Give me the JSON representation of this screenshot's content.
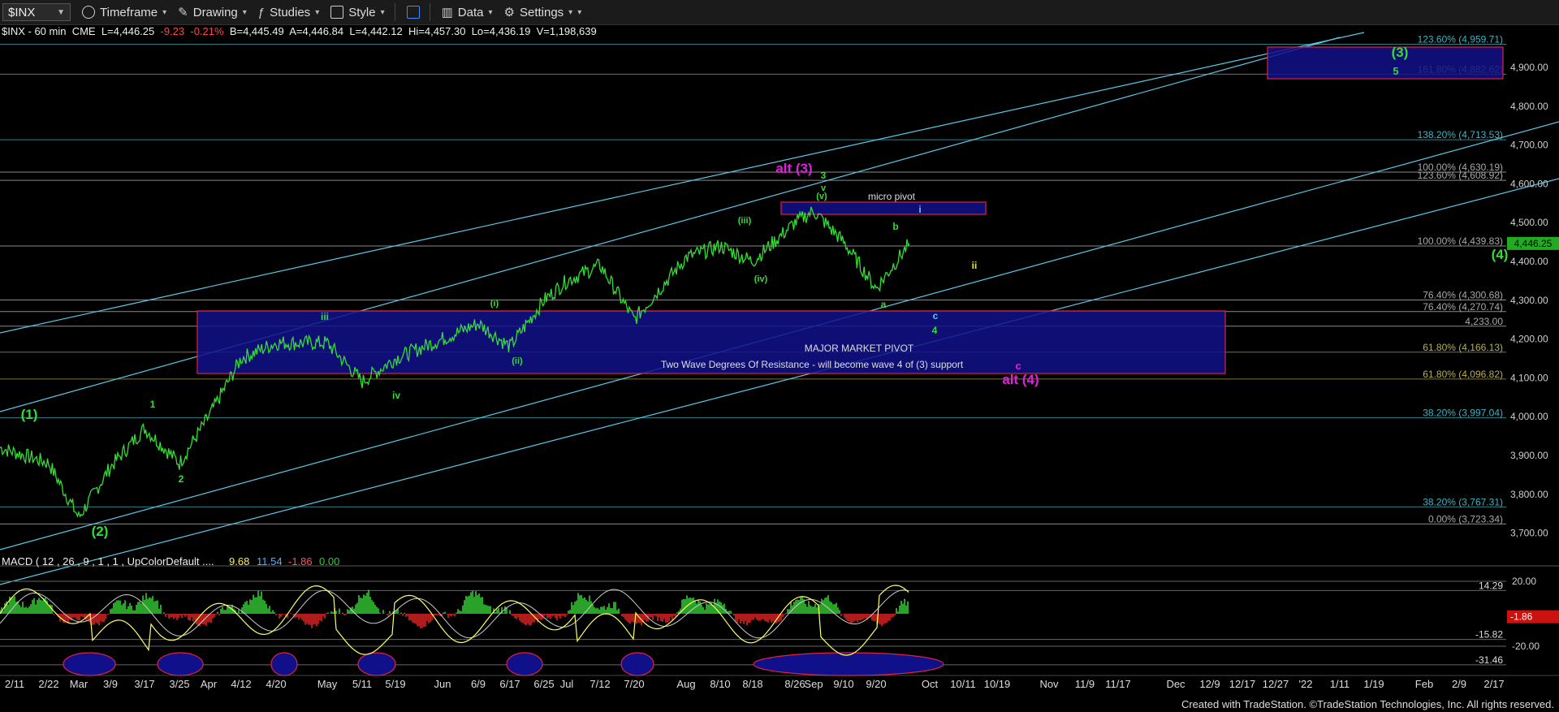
{
  "toolbar": {
    "symbol": "$INX",
    "items": [
      {
        "label": "Timeframe",
        "icon": "clock-icon"
      },
      {
        "label": "Drawing",
        "icon": "pencil-icon"
      },
      {
        "label": "Studies",
        "icon": "studies-icon"
      },
      {
        "label": "Style",
        "icon": "style-icon"
      },
      {
        "label": "",
        "icon": "layout-icon"
      },
      {
        "label": "Data",
        "icon": "data-icon"
      },
      {
        "label": "Settings",
        "icon": "gear-icon"
      }
    ]
  },
  "header": {
    "name": "$INX - 60 min  CME",
    "last": "L=4,446.25",
    "change": "-9.23",
    "pct": "-0.21%",
    "bid": "B=4,445.49",
    "ask": "A=4,446.84",
    "bar_last": "L=4,442.12",
    "hi": "Hi=4,457.30",
    "lo": "Lo=4,436.19",
    "vol": "V=1,198,639"
  },
  "footer": "Created with TradeStation. ©TradeStation Technologies, Inc. All rights reserved.",
  "colors": {
    "background": "#000000",
    "price": "#33dd33",
    "channel": "#5bc8e8",
    "zone_fill": "#10108a",
    "zone_border": "#dd2244",
    "fib_text": "#39b5c4",
    "fib_yellow": "#b8b04a",
    "wave_green": "#33dd33",
    "wave_magenta": "#dd22dd",
    "wave_yellow": "#e8e820",
    "macd_line": "#ffff66",
    "macd_signal": "#cccccc",
    "hist_pos": "#33cc33",
    "hist_neg": "#dd2222",
    "oval_fill": "#10108a"
  },
  "chart_data": [
    {
      "type": "line",
      "series": [
        {
          "x": [
            "2/11",
            "2/22",
            "Mar",
            "3/9",
            "3/17",
            "3/25",
            "Apr",
            "4/12",
            "4/20",
            "May",
            "5/11",
            "5/19",
            "Jun",
            "6/9",
            "6/17",
            "6/25",
            "Jul",
            "7/12",
            "7/20",
            "Aug",
            "8/10",
            "8/18",
            "8/26",
            "Sep",
            "9/10",
            "9/20",
            "Oct"
          ],
          "values": [
            3920,
            3880,
            3740,
            3870,
            3970,
            3880,
            4000,
            4150,
            4190,
            4190,
            4090,
            4150,
            4200,
            4240,
            4180,
            4300,
            4350,
            4390,
            4250,
            4410,
            4440,
            4400,
            4500,
            4530,
            4450,
            4330,
            4446
          ]
        }
      ],
      "yticks": [
        "3,700.00",
        "3,800.00",
        "3,900.00",
        "4,000.00",
        "4,100.00",
        "4,200.00",
        "4,300.00",
        "4,400.00",
        "4,500.00",
        "4,600.00",
        "4,700.00",
        "4,800.00",
        "4,900.00"
      ],
      "ylim": [
        3630,
        4990
      ],
      "last_price_label": "4,446.25",
      "fib_levels": [
        {
          "label": "123.60% (4,959.71)",
          "value": 4959.71,
          "color": "cyan"
        },
        {
          "label": "161.80% (4,882.62)",
          "value": 4882.62,
          "color": "yellow"
        },
        {
          "label": "138.20% (4,713.53)",
          "value": 4713.53,
          "color": "cyan"
        },
        {
          "label": "100.00% (4,630.19)",
          "value": 4630.19,
          "color": "white"
        },
        {
          "label": "123.60% (4,608.92)",
          "value": 4608.92,
          "color": "white"
        },
        {
          "label": "100.00% (4,439.83)",
          "value": 4439.83,
          "color": "white"
        },
        {
          "label": "76.40% (4,300.68)",
          "value": 4300.68,
          "color": "white"
        },
        {
          "label": "76.40% (4,270.74)",
          "value": 4270.74,
          "color": "white"
        },
        {
          "label": "4,233.00",
          "value": 4233.0,
          "color": "white"
        },
        {
          "label": "61.80% (4,166.13)",
          "value": 4166.13,
          "color": "yellow"
        },
        {
          "label": "61.80% (4,096.82)",
          "value": 4096.82,
          "color": "yellow"
        },
        {
          "label": "38.20% (3,997.04)",
          "value": 3997.04,
          "color": "cyan"
        },
        {
          "label": "38.20% (3,767.31)",
          "value": 3767.31,
          "color": "cyan"
        },
        {
          "label": "0.00% (3,723.34)",
          "value": 3723.34,
          "color": "white"
        }
      ],
      "zones": [
        {
          "label1": "MAJOR MARKET PIVOT",
          "label2": "Two Wave Degrees Of Resistance - will become wave 4 of (3) support",
          "x0": "4/1",
          "x1": "12/10",
          "y0": 4098,
          "y1": 4270
        },
        {
          "label1": "micro pivot",
          "label2": "",
          "x0": "8/26",
          "x1": "10/10",
          "y0": 4525,
          "y1": 4558
        },
        {
          "label1": "",
          "label2": "",
          "x0": "12/27",
          "x1": "2/17",
          "y0": 4883,
          "y1": 4966
        }
      ],
      "wave_labels": [
        {
          "text": "(1)",
          "color": "green"
        },
        {
          "text": "(2)",
          "color": "green"
        },
        {
          "text": "1",
          "color": "green"
        },
        {
          "text": "2",
          "color": "green"
        },
        {
          "text": "iii",
          "color": "green"
        },
        {
          "text": "iv",
          "color": "green"
        },
        {
          "text": "(i)",
          "color": "green"
        },
        {
          "text": "(ii)",
          "color": "green"
        },
        {
          "text": "(iii)",
          "color": "green"
        },
        {
          "text": "(iv)",
          "color": "green"
        },
        {
          "text": "(v)",
          "color": "green"
        },
        {
          "text": "v",
          "color": "green"
        },
        {
          "text": "3",
          "color": "green"
        },
        {
          "text": "alt (3)",
          "color": "magenta"
        },
        {
          "text": "a",
          "color": "green"
        },
        {
          "text": "b",
          "color": "green"
        },
        {
          "text": "c",
          "color": "cyan"
        },
        {
          "text": "4",
          "color": "green"
        },
        {
          "text": "i",
          "color": "cyan"
        },
        {
          "text": "ii",
          "color": "yellow"
        },
        {
          "text": "c",
          "color": "magenta"
        },
        {
          "text": "alt (4)",
          "color": "magenta"
        },
        {
          "text": "(3)",
          "color": "green"
        },
        {
          "text": "5",
          "color": "green"
        },
        {
          "text": "(4)",
          "color": "green"
        }
      ],
      "xticks": [
        "2/11",
        "2/22",
        "Mar",
        "3/9",
        "3/17",
        "3/25",
        "Apr",
        "4/12",
        "4/20",
        "May",
        "5/11",
        "5/19",
        "Jun",
        "6/9",
        "6/17",
        "6/25",
        "Jul",
        "7/12",
        "7/20",
        "Aug",
        "8/10",
        "8/18",
        "8/26",
        "Sep",
        "9/10",
        "9/20",
        "Oct",
        "10/11",
        "10/19",
        "Nov",
        "11/9",
        "11/17",
        "Dec",
        "12/9",
        "12/17",
        "12/27",
        "'22",
        "1/11",
        "1/19",
        "Feb",
        "2/9",
        "2/17"
      ]
    },
    {
      "type": "bar",
      "title": "MACD ( 12 , 26 , 9 , 1 , 1 , UpColorDefault ....",
      "values_text": [
        "9.68",
        "11.54",
        "-1.86",
        "0.00"
      ],
      "yticks": [
        "20.00",
        "-20.00"
      ],
      "level_labels": [
        "14.29",
        "-15.82",
        "-31.46"
      ],
      "last_label": "-1.86",
      "ylim": [
        -36,
        28
      ]
    }
  ]
}
